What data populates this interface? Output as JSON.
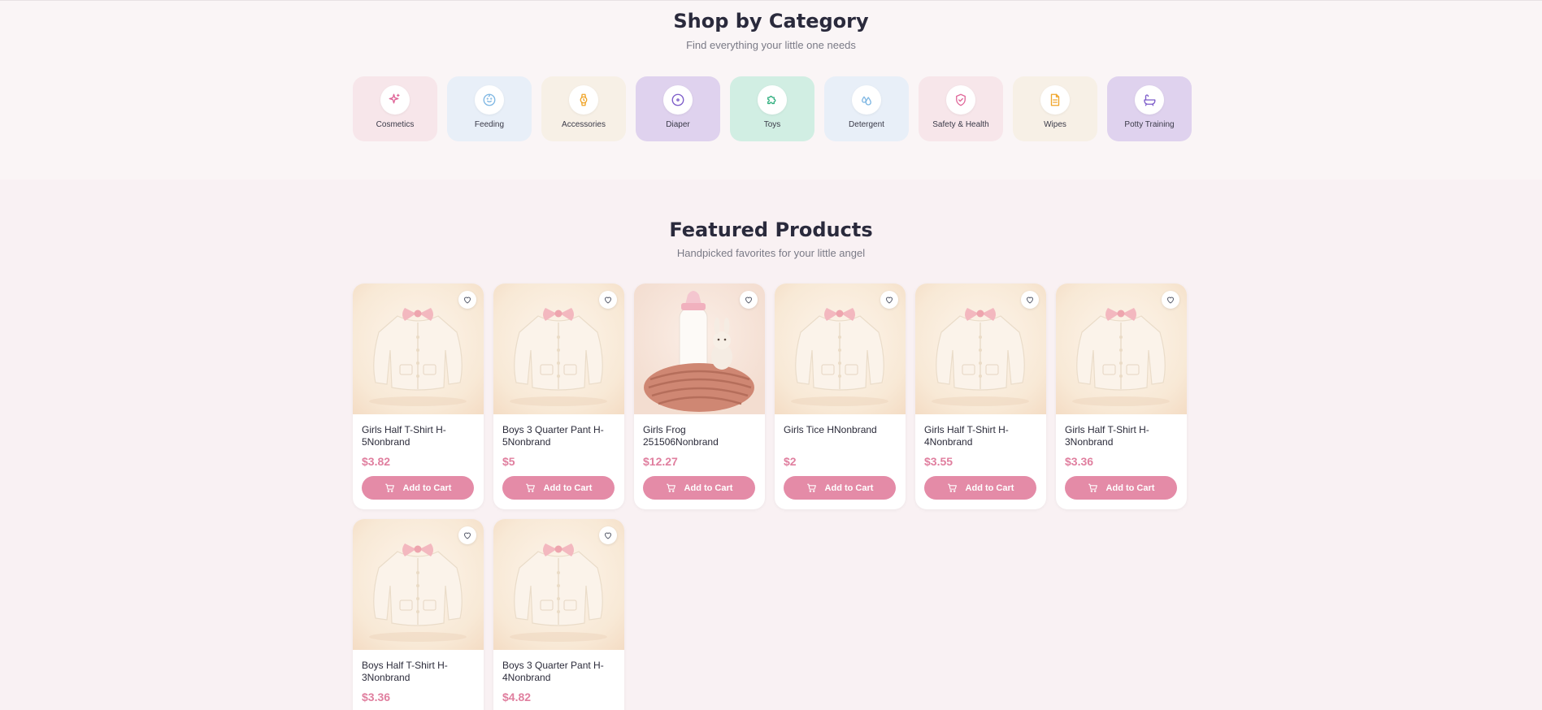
{
  "categories_section": {
    "title": "Shop by Category",
    "subtitle": "Find everything your little one needs",
    "items": [
      {
        "label": "Cosmetics",
        "icon": "sparkle-icon",
        "bg": "#f7e6ea",
        "color": "#e0689a"
      },
      {
        "label": "Feeding",
        "icon": "baby-face-icon",
        "bg": "#e8eff8",
        "color": "#7fb7e3"
      },
      {
        "label": "Accessories",
        "icon": "watch-icon",
        "bg": "#f7f0e6",
        "color": "#f0a52a"
      },
      {
        "label": "Diaper",
        "icon": "circle-dot-icon",
        "bg": "#dfd2ee",
        "color": "#7c5bc9"
      },
      {
        "label": "Toys",
        "icon": "puzzle-icon",
        "bg": "#d1eee3",
        "color": "#2fae7e"
      },
      {
        "label": "Detergent",
        "icon": "droplets-icon",
        "bg": "#e8eff8",
        "color": "#7fb7e3"
      },
      {
        "label": "Safety & Health",
        "icon": "shield-check-icon",
        "bg": "#f7e6ea",
        "color": "#e0689a"
      },
      {
        "label": "Wipes",
        "icon": "document-icon",
        "bg": "#f7f0e6",
        "color": "#f0a52a"
      },
      {
        "label": "Potty Training",
        "icon": "bathtub-icon",
        "bg": "#dfd2ee",
        "color": "#7c5bc9"
      }
    ]
  },
  "featured_section": {
    "title": "Featured Products",
    "subtitle": "Handpicked favorites for your little angel",
    "add_to_cart_label": "Add to Cart",
    "products": [
      {
        "name": "Girls Half T-Shirt H-5Nonbrand",
        "price": "$3.82",
        "image": "cardigan"
      },
      {
        "name": "Boys 3 Quarter Pant H-5Nonbrand",
        "price": "$5",
        "image": "cardigan"
      },
      {
        "name": "Girls Frog 251506Nonbrand",
        "price": "$12.27",
        "image": "bottle"
      },
      {
        "name": "Girls Tice HNonbrand",
        "price": "$2",
        "image": "cardigan"
      },
      {
        "name": "Girls Half T-Shirt H-4Nonbrand",
        "price": "$3.55",
        "image": "cardigan"
      },
      {
        "name": "Girls Half T-Shirt H-3Nonbrand",
        "price": "$3.36",
        "image": "cardigan"
      },
      {
        "name": "Boys Half T-Shirt H-3Nonbrand",
        "price": "$3.36",
        "image": "cardigan"
      },
      {
        "name": "Boys 3 Quarter Pant H-4Nonbrand",
        "price": "$4.82",
        "image": "cardigan"
      }
    ]
  },
  "colors": {
    "accent": "#e48ba7",
    "price": "#e07f9f",
    "page_bg": "#f9f1f3"
  }
}
